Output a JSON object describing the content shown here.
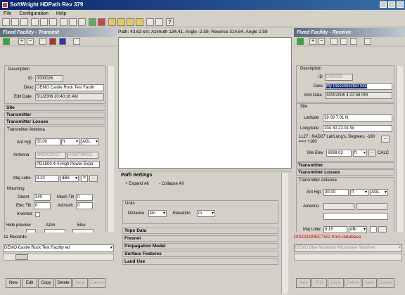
{
  "window": {
    "title": "SoftWright HDPath Rev 379"
  },
  "menu": [
    "File",
    "Configuration",
    "Help"
  ],
  "path_info": "Path: 43.63 km; Azimuth 134.41, Angle -2.59; Reverse 314.64, Angle 2.59",
  "left": {
    "header": "Fixed Facility - Transmit",
    "description_title": "Description",
    "id_label": "ID",
    "id_value": "0000026",
    "desc_label": "Desc",
    "desc_value": "DEMO Castle Rock Test Facilit",
    "edit_label": "Edit Date",
    "edit_value": "5/1/2006 10:40:16 AM",
    "sections": [
      "Site",
      "Transmitter",
      "Transmitter Losses"
    ],
    "antenna_group": "Transmitter Antenna",
    "ant_hgt_label": "Ant Hgt",
    "ant_hgt_value": "50.00",
    "ant_hgt_unit": "ft",
    "ant_hgt_ref": "AGL",
    "antenna_label": "Antenna",
    "antenna_code1": "AMSX20027",
    "antenna_code2": "2002700012",
    "antenna_desc": "PD1500-4-4 High Power Expo",
    "maj_lobe_label": "Maj Lobe",
    "maj_lobe_value": "9.10",
    "maj_lobe_unit": "dBd",
    "mounting_label": "Mounting",
    "orient_label": "Orient",
    "orient_value": "340",
    "mech_tilt_label": "Mech Tilt",
    "mech_tilt_value": "0",
    "elec_tilt_label": "Elec Tilt",
    "elec_tilt_value": "0",
    "azimuth_label": "Azimuth",
    "azimuth_value": "0",
    "inverted_label": "Inverted",
    "hide_preview_label": "Hide preview",
    "azim_label": "Azim",
    "elev_label": "Elev",
    "records": "11 Records",
    "facility_select": "DEMO Castle Rock Test Facility ed",
    "buttons": [
      "New",
      "Edit",
      "Copy",
      "Delete",
      "Save",
      "Cancel"
    ]
  },
  "right": {
    "header": "Fixed Facility - Receive",
    "description_title": "Description",
    "id_label": "ID",
    "id_value": "0000025",
    "desc_label": "Desc",
    "desc_value": "My Disconnected Site",
    "edit_label": "Edit Date",
    "edit_value": "3/29/2006 4:22:58 PM",
    "site_title": "Site",
    "lat_label": "Latitude",
    "lat_value": "39 09 7.01 N",
    "lon_label": "Longitude",
    "lon_value": "104 30 22.01 W",
    "datum_text": "LL27 : NAD27 Lat/Long's, Degrees, -180 ==> +180",
    "site_elev_label": "Site Elev",
    "site_elev_value": "6998.03",
    "site_elev_unit": "ft",
    "calc_label": "CALC",
    "sections": [
      "Transmitter",
      "Transmitter Losses"
    ],
    "antenna_group": "Transmitter Antenna",
    "ant_hgt_label": "Ant Hgt",
    "ant_hgt_value": "30.00",
    "ant_hgt_unit": "ft",
    "ant_hgt_ref": "AGL",
    "antenna_label": "Antenna",
    "maj_lobe_label": "Maj Lobe",
    "maj_lobe_value": "5.15",
    "maj_lobe_unit": "dBi",
    "status": "DISCONNECTED from database",
    "facility_select": "DEMO Blue Mountain Microwave Receiver",
    "buttons": [
      "New",
      "Edit",
      "Copy",
      "Delete",
      "Save",
      "Cancel"
    ]
  },
  "path_settings": {
    "header": "Path Settings",
    "expand": "+ Expand All",
    "collapse": "- Collapse All",
    "units_title": "Units",
    "distance_label": "Distance",
    "distance_value": "km",
    "elevation_label": "Elevation",
    "elevation_value": "m",
    "sections": [
      "Topo Data",
      "Fresnel",
      "Propagation Model",
      "Surface Features",
      "Land Use"
    ]
  },
  "colors": {
    "title_start": "#0a246a",
    "title_end": "#3a6ea5",
    "status": "#cc0000",
    "selection": "#0a246a"
  }
}
